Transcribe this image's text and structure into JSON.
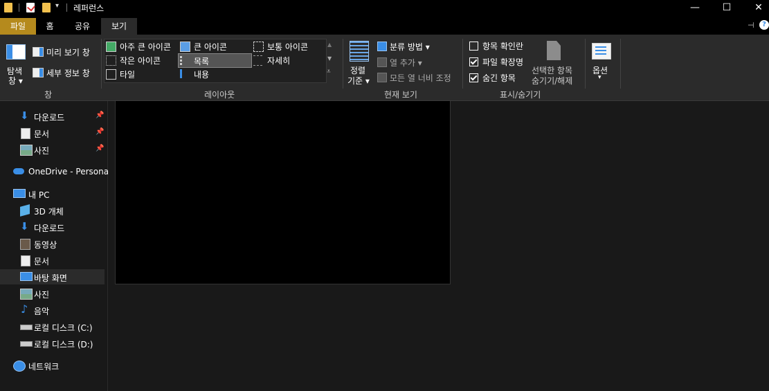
{
  "window": {
    "title": "레퍼런스",
    "minimize": "—",
    "maximize": "☐",
    "close": "✕"
  },
  "tabs": [
    {
      "label": "파일"
    },
    {
      "label": "홈"
    },
    {
      "label": "공유"
    },
    {
      "label": "보기"
    }
  ],
  "ribbon": {
    "pane_group": {
      "label": "창",
      "nav_pane": "탐색\n창",
      "nav_pane_line1": "탐색",
      "nav_pane_line2": "창 ▾",
      "preview_pane": "미리 보기 창",
      "details_pane": "세부 정보 창"
    },
    "layout_group": {
      "label": "레이아웃",
      "options": [
        {
          "label": "아주 큰 아이콘"
        },
        {
          "label": "큰 아이콘"
        },
        {
          "label": "보통 아이콘"
        },
        {
          "label": "작은 아이콘"
        },
        {
          "label": "목록",
          "selected": true
        },
        {
          "label": "자세히"
        },
        {
          "label": "타일"
        },
        {
          "label": "내용"
        }
      ]
    },
    "current_view_group": {
      "label": "현재 보기",
      "sort_line1": "정렬",
      "sort_line2": "기준 ▾",
      "group_by": "분류 방법 ▾",
      "add_columns": "열 추가 ▾",
      "fit_columns": "모든 열 너비 조정"
    },
    "show_hide_group": {
      "label": "표시/숨기기",
      "item_checkboxes": {
        "label": "항목 확인란",
        "checked": false
      },
      "file_extensions": {
        "label": "파일 확장명",
        "checked": true
      },
      "hidden_items": {
        "label": "숨긴 항목",
        "checked": true
      },
      "hide_selected_line1": "선택한 항목",
      "hide_selected_line2": "숨기기/해제"
    },
    "options_group": {
      "options_label": "옵션",
      "options_arrow": "▾"
    }
  },
  "sidebar": {
    "quick_access": [
      {
        "label": "다운로드",
        "pinned": true
      },
      {
        "label": "문서",
        "pinned": true
      },
      {
        "label": "사진",
        "pinned": true
      }
    ],
    "onedrive": "OneDrive - Personal",
    "this_pc": "내 PC",
    "pc_items": [
      {
        "label": "3D 개체"
      },
      {
        "label": "다운로드"
      },
      {
        "label": "동영상"
      },
      {
        "label": "문서"
      },
      {
        "label": "바탕 화면",
        "selected": true
      },
      {
        "label": "사진"
      },
      {
        "label": "음악"
      },
      {
        "label": "로컬 디스크 (C:)"
      },
      {
        "label": "로컬 디스크 (D:)"
      }
    ],
    "network": "네트워크"
  },
  "colors": {
    "file_tab": "#b58a1d",
    "accent_blue": "#3a8ee6",
    "folder_yellow": "#f2c14e"
  }
}
